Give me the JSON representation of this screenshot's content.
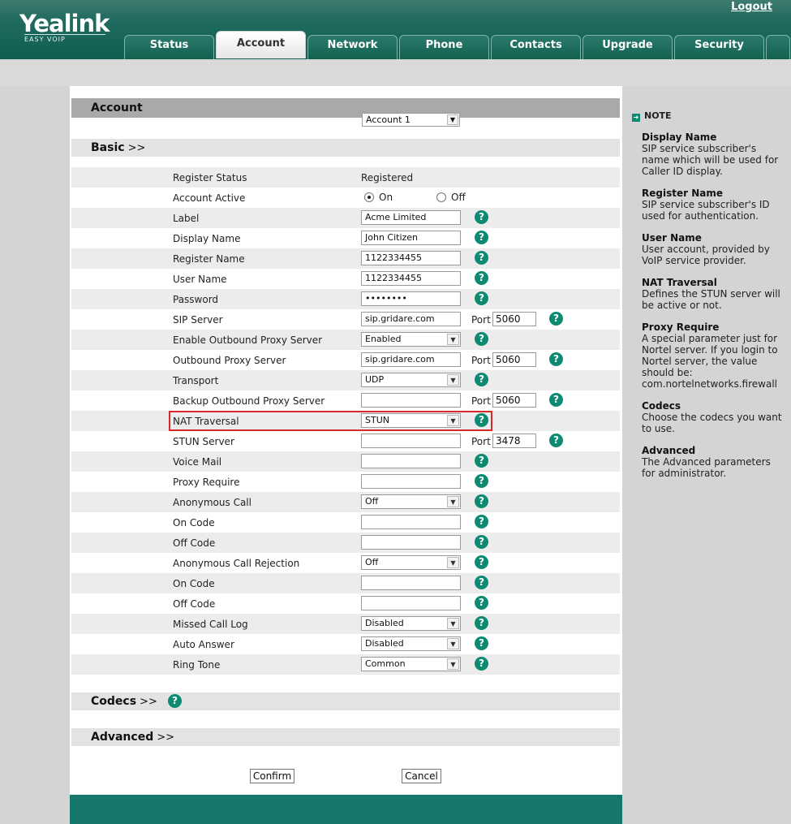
{
  "header": {
    "logo": "Yealink",
    "logo_sub": "EASY VOIP",
    "logout": "Logout",
    "tabs": [
      "Status",
      "Account",
      "Network",
      "Phone",
      "Contacts",
      "Upgrade",
      "Security"
    ]
  },
  "account": {
    "label": "Account",
    "selected": "Account 1"
  },
  "sections": {
    "basic": "Basic",
    "codecs": "Codecs",
    "advanced": "Advanced",
    "arrows": ">>"
  },
  "rows": {
    "register_status": {
      "label": "Register Status",
      "value": "Registered"
    },
    "account_active": {
      "label": "Account Active",
      "on": "On",
      "off": "Off"
    },
    "label": {
      "label": "Label",
      "value": "Acme Limited"
    },
    "display_name": {
      "label": "Display Name",
      "value": "John Citizen"
    },
    "register_name": {
      "label": "Register Name",
      "value": "1122334455"
    },
    "user_name": {
      "label": "User Name",
      "value": "1122334455"
    },
    "password": {
      "label": "Password",
      "value": "••••••••"
    },
    "sip_server": {
      "label": "SIP Server",
      "value": "sip.gridare.com",
      "port": "5060"
    },
    "enable_outbound": {
      "label": "Enable Outbound Proxy Server",
      "value": "Enabled"
    },
    "outbound_proxy": {
      "label": "Outbound Proxy Server",
      "value": "sip.gridare.com",
      "port": "5060"
    },
    "transport": {
      "label": "Transport",
      "value": "UDP"
    },
    "backup_outbound": {
      "label": "Backup Outbound Proxy Server",
      "value": "",
      "port": "5060"
    },
    "nat_traversal": {
      "label": "NAT Traversal",
      "value": "STUN"
    },
    "stun_server": {
      "label": "STUN Server",
      "value": "",
      "port": "3478"
    },
    "voice_mail": {
      "label": "Voice Mail",
      "value": ""
    },
    "proxy_require": {
      "label": "Proxy Require",
      "value": ""
    },
    "anonymous_call": {
      "label": "Anonymous Call",
      "value": "Off"
    },
    "on_code_1": {
      "label": "On Code",
      "value": ""
    },
    "off_code_1": {
      "label": "Off Code",
      "value": ""
    },
    "anon_rejection": {
      "label": "Anonymous Call Rejection",
      "value": "Off"
    },
    "on_code_2": {
      "label": "On Code",
      "value": ""
    },
    "off_code_2": {
      "label": "Off Code",
      "value": ""
    },
    "missed_call_log": {
      "label": "Missed Call Log",
      "value": "Disabled"
    },
    "auto_answer": {
      "label": "Auto Answer",
      "value": "Disabled"
    },
    "ring_tone": {
      "label": "Ring Tone",
      "value": "Common"
    }
  },
  "common": {
    "port": "Port",
    "help": "?",
    "dropdown": "▼"
  },
  "buttons": {
    "confirm": "Confirm",
    "cancel": "Cancel"
  },
  "notes": {
    "heading": "NOTE",
    "items": [
      {
        "title": "Display Name",
        "text": "SIP service subscriber's name which will be used for Caller ID display."
      },
      {
        "title": "Register Name",
        "text": "SIP service subscriber's ID used for authentication."
      },
      {
        "title": "User Name",
        "text": "User account, provided by VoIP service provider."
      },
      {
        "title": "NAT Traversal",
        "text": "Defines the STUN server will be active or not."
      },
      {
        "title": "Proxy Require",
        "text": "A special parameter just for Nortel server. If you login to Nortel server, the value should be: com.nortelnetworks.firewall"
      },
      {
        "title": "Codecs",
        "text": "Choose the codecs you want to use."
      },
      {
        "title": "Advanced",
        "text": "The Advanced parameters for administrator."
      }
    ]
  },
  "colors": {
    "brand": "#16776a",
    "help_icon": "#0e8a73",
    "highlight": "#d42a2a"
  }
}
